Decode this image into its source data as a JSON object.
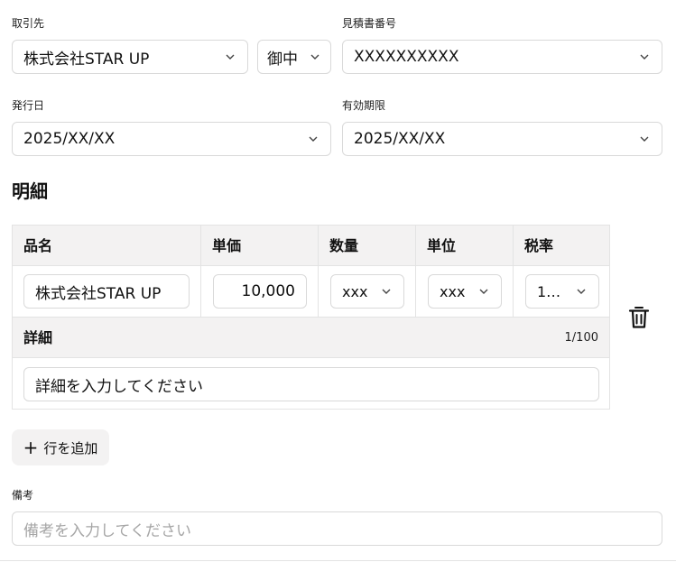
{
  "client": {
    "label": "取引先",
    "company_value": "株式会社STAR UP",
    "honorific_value": "御中"
  },
  "quote_number": {
    "label": "見積書番号",
    "value": "XXXXXXXXXX"
  },
  "issue_date": {
    "label": "発行日",
    "value": "2025/XX/XX"
  },
  "expiry": {
    "label": "有効期限",
    "value": "2025/XX/XX"
  },
  "details_section": {
    "title": "明細"
  },
  "table": {
    "headers": [
      "品名",
      "単価",
      "数量",
      "単位",
      "税率"
    ],
    "row": {
      "item_name": "株式会社STAR UP",
      "unit_price": "10,000",
      "quantity": "xxx",
      "unit": "xxx",
      "tax_rate": "1…"
    },
    "detail": {
      "title": "詳細",
      "count": "1/100",
      "value": "詳細を入力してください"
    }
  },
  "add_row": {
    "label": "行を追加"
  },
  "notes": {
    "label": "備考",
    "placeholder": "備考を入力してください"
  },
  "icons": {
    "dropdown": "chevron-down-icon",
    "delete": "trash-icon",
    "add": "plus-icon"
  }
}
